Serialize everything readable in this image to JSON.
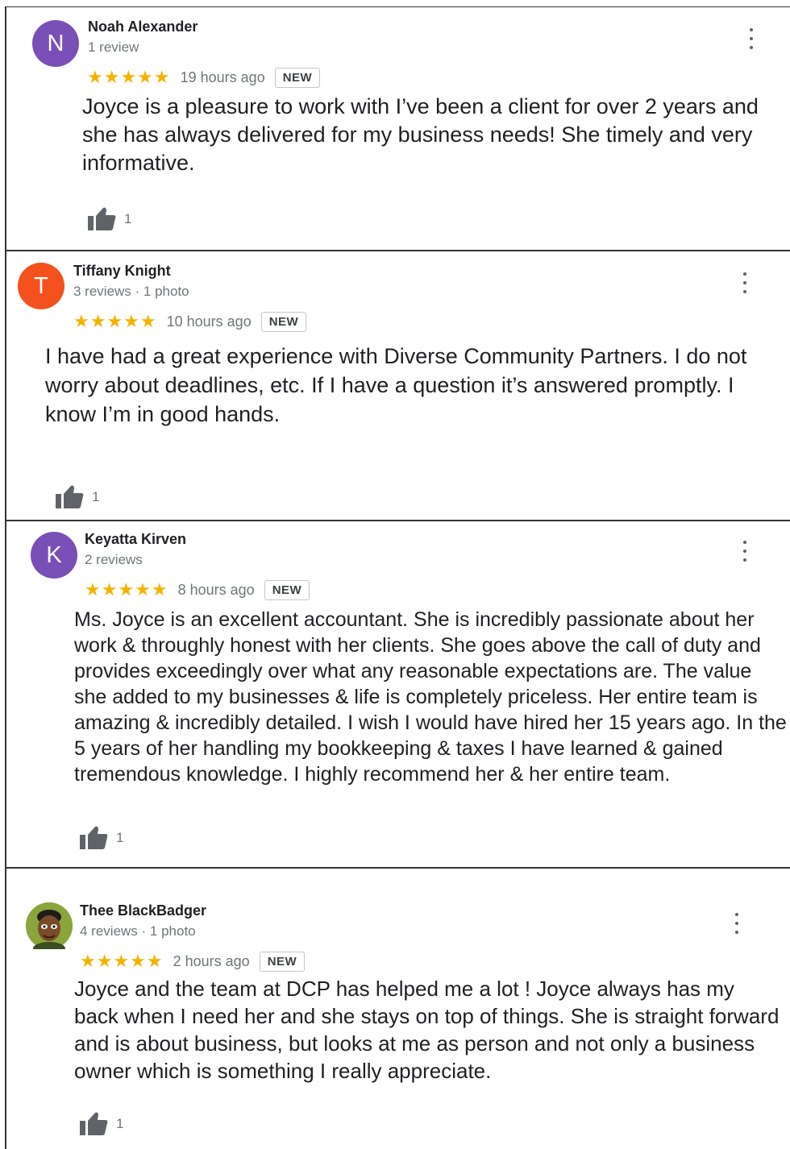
{
  "reviews": [
    {
      "avatar_letter": "N",
      "avatar_color": "#7a4fb5",
      "name": "Noah Alexander",
      "meta": "1 review",
      "stars": "★★★★★",
      "time": "19 hours ago",
      "badge": "NEW",
      "text": "Joyce is a pleasure to work with I’ve been a client for over 2 years and she has always delivered for my business needs! She timely and very informative.",
      "likes": "1",
      "more_icon": "more-vert-icon",
      "like_icon": "thumbs-up-icon"
    },
    {
      "avatar_letter": "T",
      "avatar_color": "#f4511e",
      "name": "Tiffany Knight",
      "meta": "3 reviews · 1 photo",
      "stars": "★★★★★",
      "time": "10 hours ago",
      "badge": "NEW",
      "text": "I have had a great experience with Diverse Community Partners. I do not worry about deadlines, etc. If I have a question it’s answered promptly. I know I’m in good hands.",
      "likes": "1",
      "more_icon": "more-vert-icon",
      "like_icon": "thumbs-up-icon"
    },
    {
      "avatar_letter": "K",
      "avatar_color": "#7a4fb5",
      "name": "Keyatta Kirven",
      "meta": "2 reviews",
      "stars": "★★★★★",
      "time": "8 hours ago",
      "badge": "NEW",
      "text": "Ms. Joyce is an excellent accountant. She is incredibly passionate about her work & throughly honest with her clients. She goes above the call of duty and provides exceedingly over what any reasonable expectations are. The value she added to my businesses & life is completely priceless. Her entire team is amazing & incredibly detailed. I wish I would have hired her 15 years ago. In the 5 years of her handling my bookkeeping & taxes I have learned & gained tremendous knowledge. I highly recommend her & her entire team.",
      "likes": "1",
      "more_icon": "more-vert-icon",
      "like_icon": "thumbs-up-icon"
    },
    {
      "avatar_letter": "",
      "avatar_color": "#6b8e23",
      "name": "Thee BlackBadger",
      "meta": "4 reviews · 1 photo",
      "stars": "★★★★★",
      "time": "2 hours ago",
      "badge": "NEW",
      "text": "Joyce and the team at DCP has helped me a lot ! Joyce always has my back when I need her and she stays on top of things. She is straight forward and is about business, but looks at me as person and not only a business owner which is something I really appreciate.",
      "likes": "1",
      "more_icon": "more-vert-icon",
      "like_icon": "thumbs-up-icon"
    }
  ]
}
